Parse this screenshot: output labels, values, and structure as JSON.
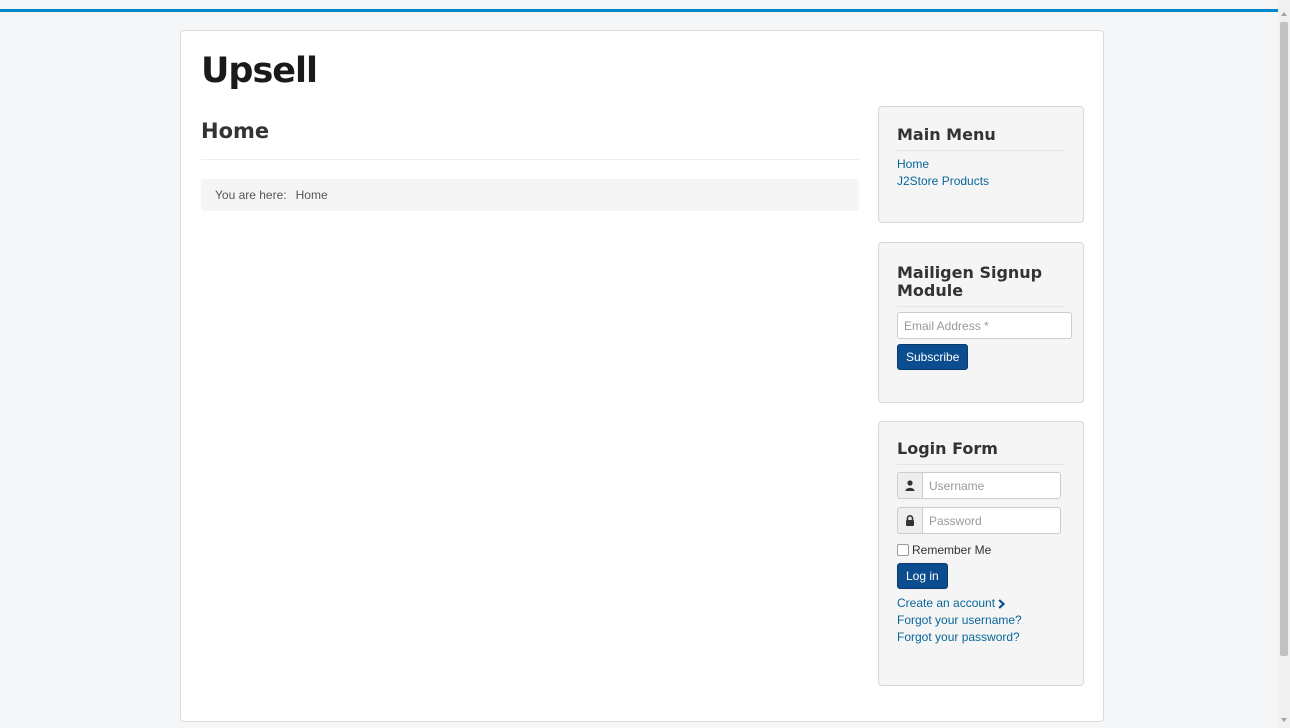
{
  "site": {
    "brand": "Upsell"
  },
  "main": {
    "page_title": "Home",
    "breadcrumb": {
      "label": "You are here:",
      "current": "Home"
    }
  },
  "main_menu": {
    "title": "Main Menu",
    "items": [
      {
        "label": "Home"
      },
      {
        "label": "J2Store Products"
      }
    ]
  },
  "signup": {
    "title": "Mailigen Signup Module",
    "email_placeholder": "Email Address *",
    "subscribe_label": "Subscribe"
  },
  "login": {
    "title": "Login Form",
    "username_placeholder": "Username",
    "password_placeholder": "Password",
    "remember_label": "Remember Me",
    "login_label": "Log in",
    "create_account": "Create an account",
    "forgot_username": "Forgot your username?",
    "forgot_password": "Forgot your password?"
  },
  "colors": {
    "accent": "#0088cc",
    "button": "#0b4d8f",
    "link": "#08669b"
  },
  "icons": [
    "user-icon",
    "lock-icon",
    "chevron-right-icon"
  ]
}
